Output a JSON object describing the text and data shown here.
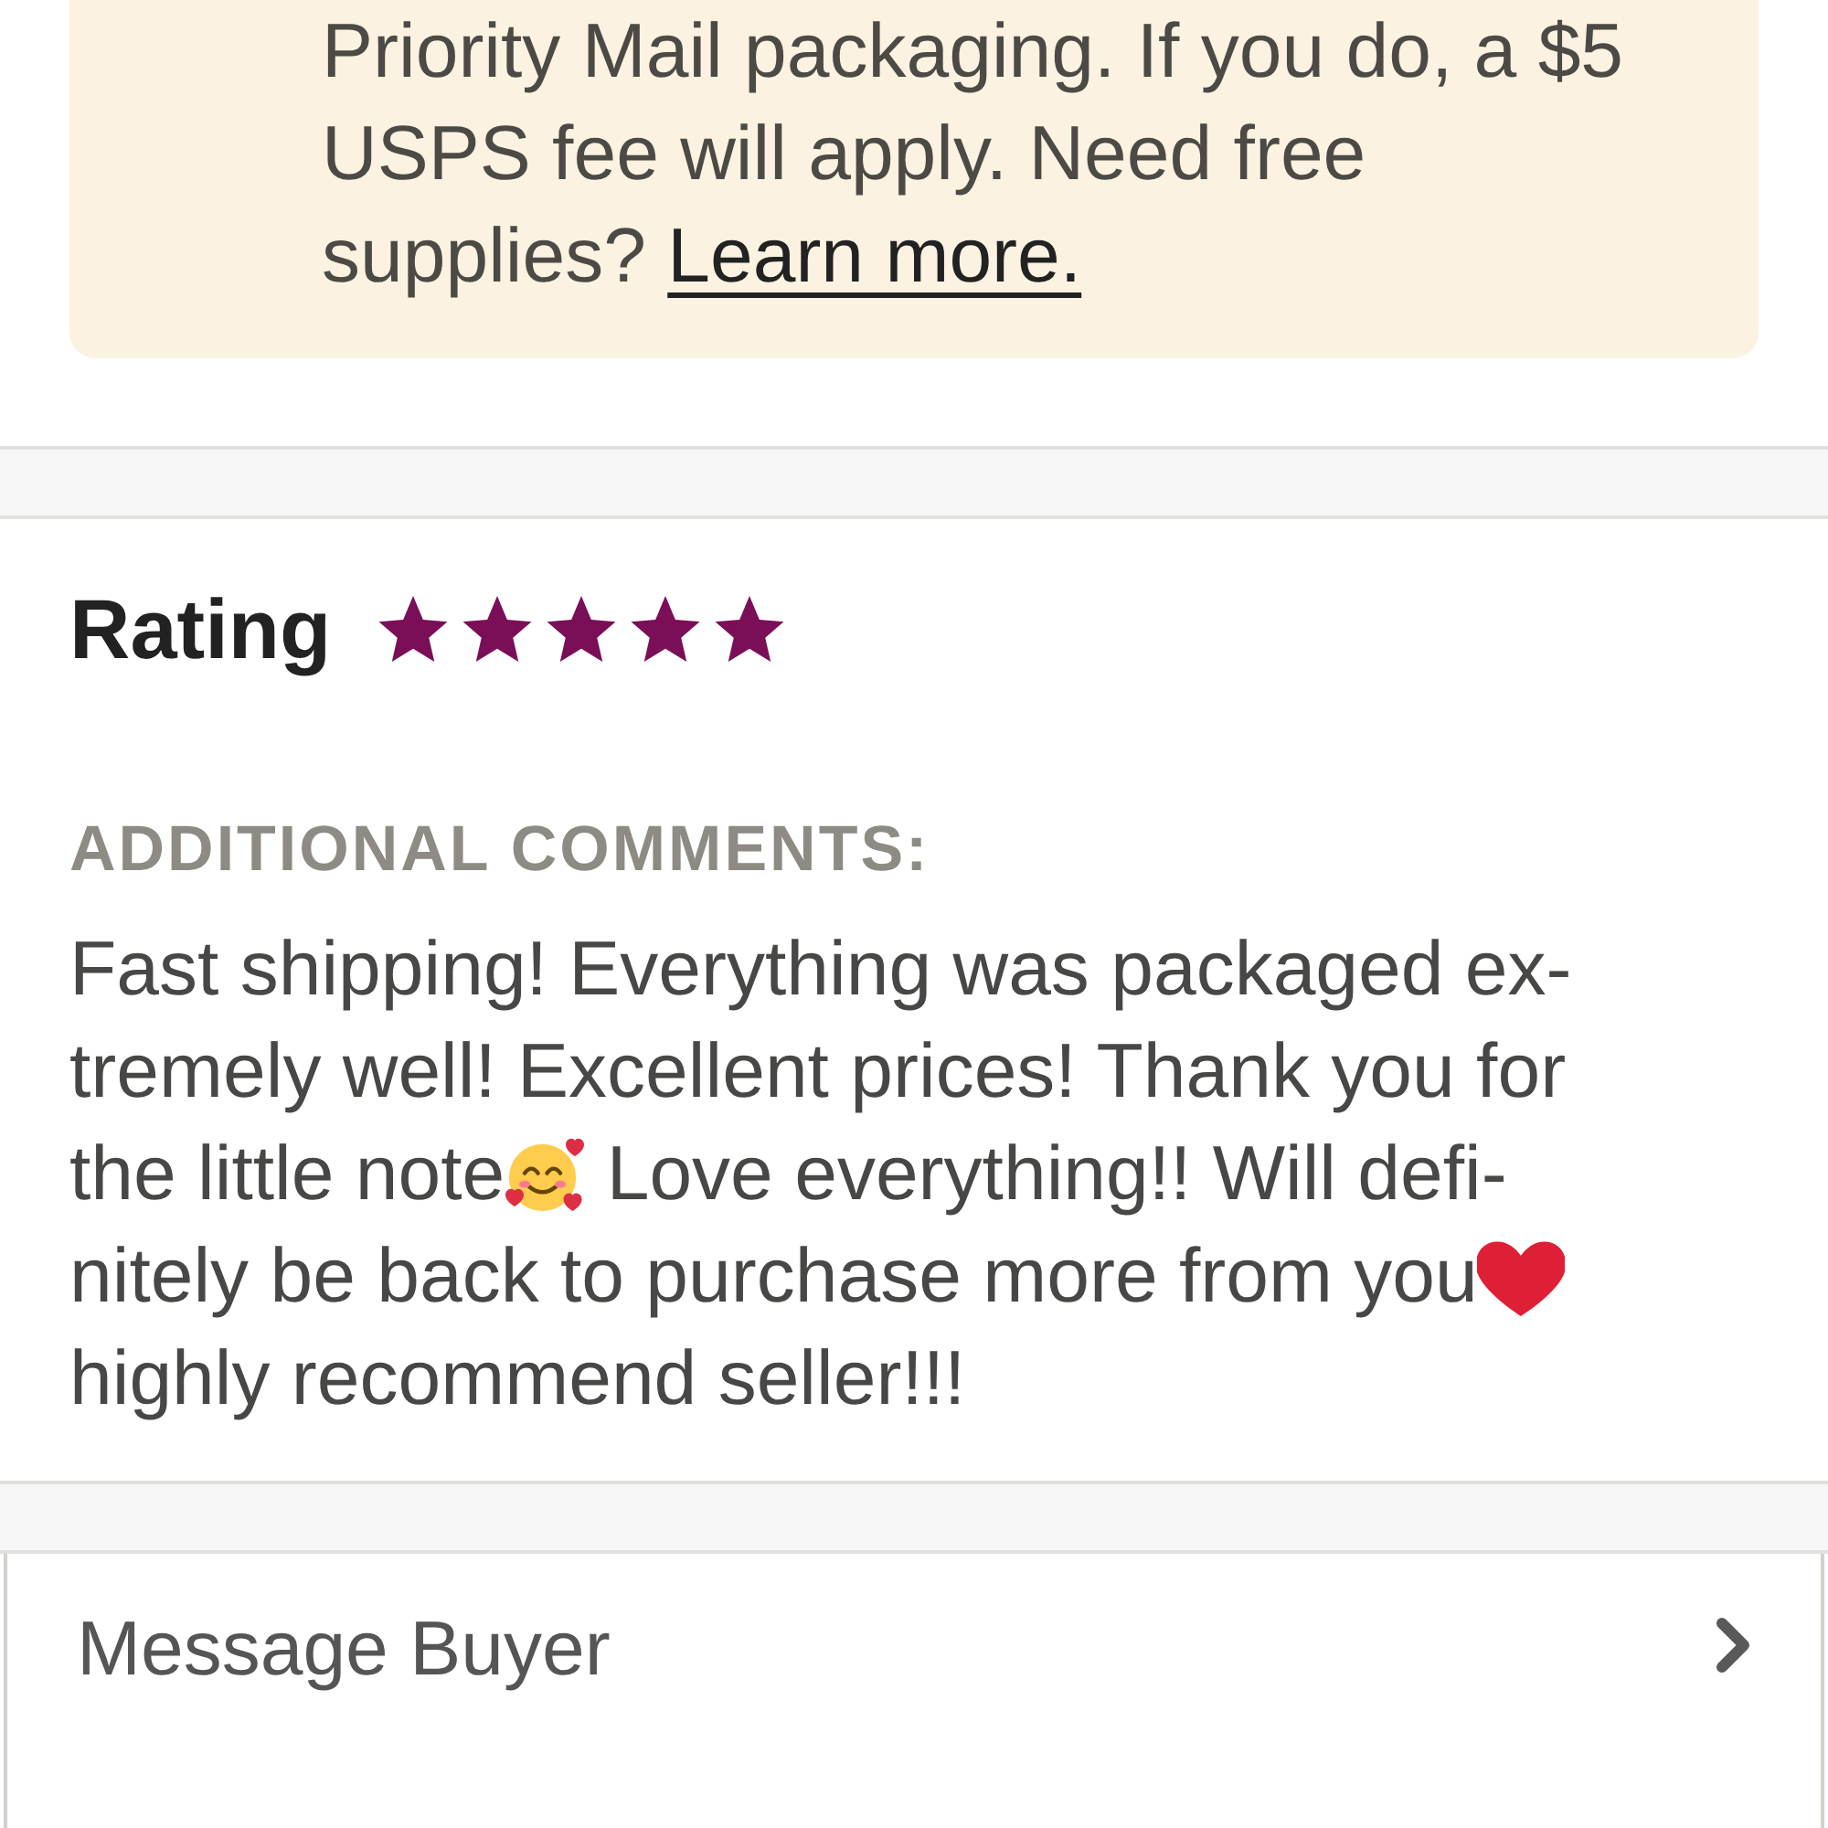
{
  "notice": {
    "text": "Priority Mail packaging. If you do, a $5\nUSPS fee will apply. Need free\nsupplies? ",
    "link": "Learn more."
  },
  "rating": {
    "label": "Rating",
    "stars": 5
  },
  "comments": {
    "heading": "ADDITIONAL COMMENTS:",
    "segments": [
      {
        "kind": "text",
        "text": "Fast shipping! Everything was packaged ex-\ntremely well! Excellent prices! Thank you for\nthe little note"
      },
      {
        "kind": "smiling-face-emoji"
      },
      {
        "kind": "text",
        "text": " Love everything!! Will defi-\nnitely be back to purchase more from you"
      },
      {
        "kind": "heart-emoji"
      },
      {
        "kind": "text",
        "text": "\nhighly recommend seller!!!"
      }
    ]
  },
  "message_buyer": {
    "label": "Message Buyer"
  }
}
